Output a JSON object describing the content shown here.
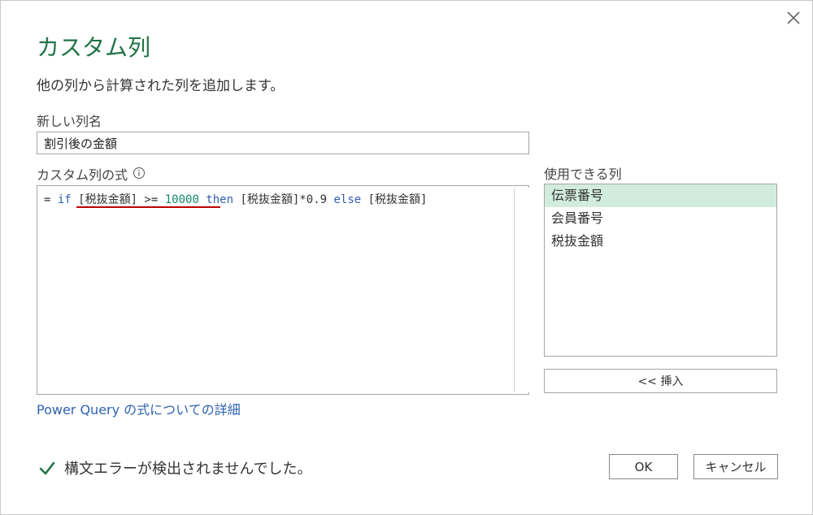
{
  "dialog": {
    "title": "カスタム列",
    "subtitle": "他の列から計算された列を追加します。",
    "close_glyph": "✕"
  },
  "new_column": {
    "label": "新しい列名",
    "value": "割引後の金額"
  },
  "formula": {
    "label": "カスタム列の式",
    "tokens": {
      "t1": "= ",
      "t2": "if",
      "t3": " [税抜金額] >= ",
      "t4": "10000",
      "t5": " ",
      "t6": "then",
      "t7": " [税抜金額]*0.9 ",
      "t8": "else",
      "t9": " [税抜金額]"
    }
  },
  "learn_more_link": "Power Query の式についての詳細",
  "available_columns": {
    "label": "使用できる列",
    "items": [
      "伝票番号",
      "会員番号",
      "税抜金額"
    ],
    "insert_label": "<< 挿入"
  },
  "status": {
    "text": "構文エラーが検出されませんでした。",
    "color": "#217346"
  },
  "buttons": {
    "ok": "OK",
    "cancel": "キャンセル"
  },
  "colors": {
    "title": "#217346",
    "selected_item": "#d2ecdc",
    "link": "#2e63b0",
    "error_underline": "#c00000"
  }
}
